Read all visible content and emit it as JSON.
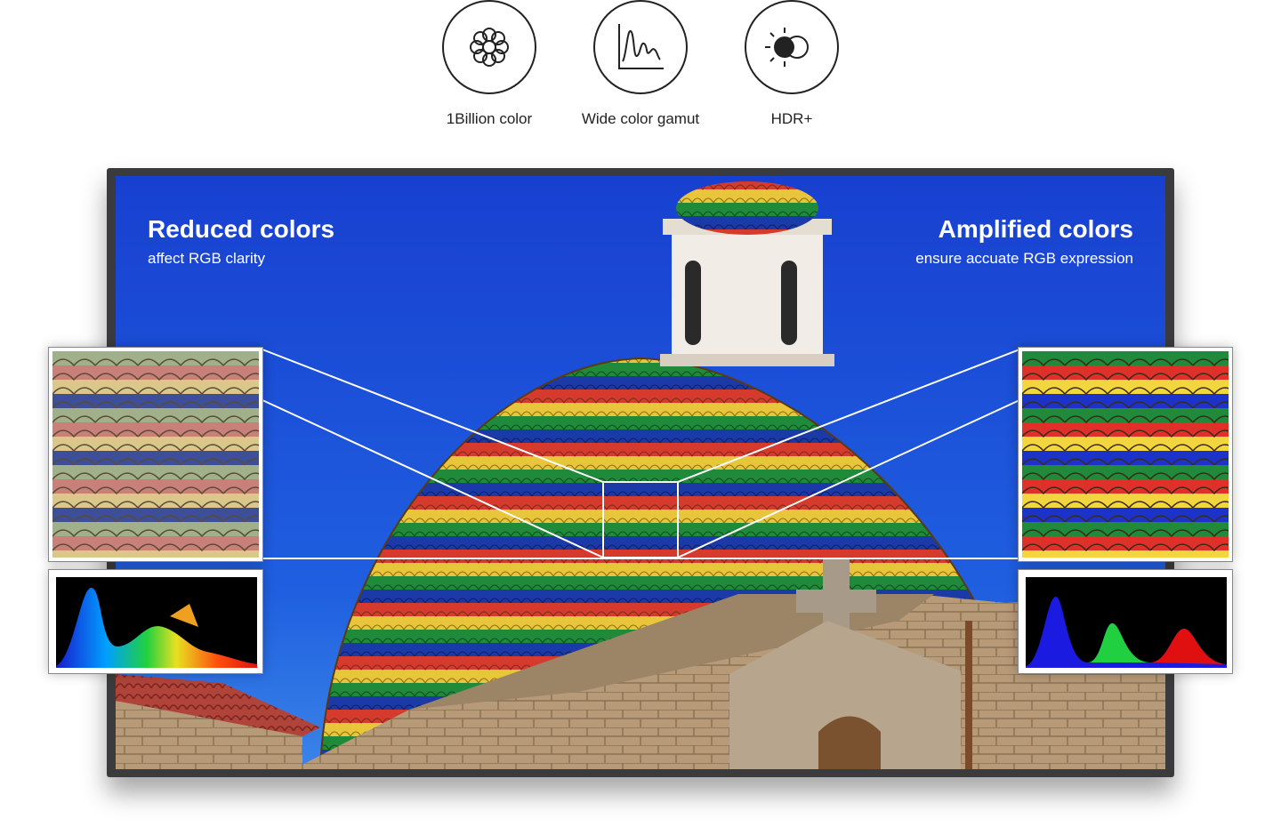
{
  "features": [
    {
      "icon": "flower-icon",
      "label": "1Billion color"
    },
    {
      "icon": "wave-graph-icon",
      "label": "Wide color gamut"
    },
    {
      "icon": "hdr-sun-icon",
      "label": "HDR+"
    }
  ],
  "left": {
    "title": "Reduced colors",
    "subtitle": "affect RGB clarity"
  },
  "right": {
    "title": "Amplified colors",
    "subtitle": "ensure accuate RGB expression"
  },
  "colors": {
    "sky": "#1a4fd6",
    "bezel": "#3b3b3d",
    "tile_red": "#d63a2c",
    "tile_yellow": "#e9c53c",
    "tile_green": "#1f8a3a",
    "tile_blue": "#1b3aa8"
  }
}
